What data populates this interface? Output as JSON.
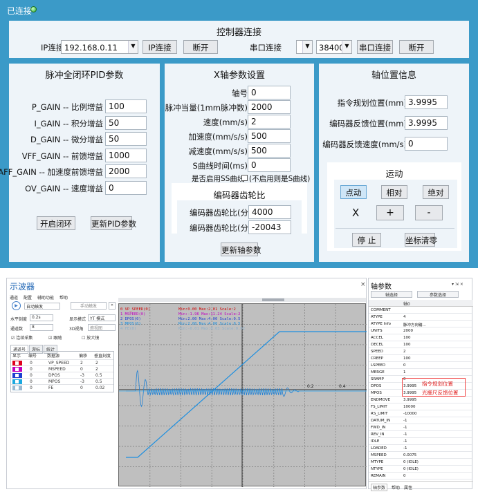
{
  "title_bar": {
    "status": "已连接"
  },
  "connect": {
    "title": "控制器连接",
    "ip_label": "IP连接",
    "ip_value": "192.168.0.11",
    "ip_button": "IP连接",
    "disconnect1": "断开",
    "serial_label": "串口连接",
    "baud_value": "38400",
    "serial_button": "串口连接",
    "disconnect2": "断开"
  },
  "pid": {
    "title": "脉冲全闭环PID参数",
    "rows": [
      {
        "label": "P_GAIN -- 比例增益",
        "value": "100"
      },
      {
        "label": "I_GAIN -- 积分增益",
        "value": "50"
      },
      {
        "label": "D_GAIN -- 微分增益",
        "value": "50"
      },
      {
        "label": "VFF_GAIN -- 前馈增益",
        "value": "1000"
      },
      {
        "label": "AFF_GAIN -- 加速度前馈增益",
        "value": "2000"
      },
      {
        "label": "OV_GAIN -- 速度增益",
        "value": "0"
      }
    ],
    "open_loop_button": "开启闭环",
    "update_button": "更新PID参数"
  },
  "xaxis": {
    "title": "X轴参数设置",
    "rows": [
      {
        "label": "轴号",
        "value": "0"
      },
      {
        "label": "脉冲当量(1mm脉冲数)",
        "value": "2000"
      },
      {
        "label": "速度(mm/s)",
        "value": "2"
      },
      {
        "label": "加速度(mm/s/s)",
        "value": "500"
      },
      {
        "label": "减速度(mm/s/s)",
        "value": "500"
      },
      {
        "label": "S曲线时间(ms)",
        "value": "0"
      }
    ],
    "s_curve_label": "是否启用SS曲线",
    "s_curve_note": "(不启用则是S曲线)",
    "gear_title": "编码器齿轮比",
    "gear_num_label": "编码器齿轮比(分子)",
    "gear_num": "4000",
    "gear_den_label": "编码器齿轮比(分母)",
    "gear_den": "-20043",
    "update_button": "更新轴参数"
  },
  "pos": {
    "title": "轴位置信息",
    "rows": [
      {
        "label": "指令规划位置(mm)",
        "value": "3.9995"
      },
      {
        "label": "编码器反馈位置(mm)",
        "value": "3.9995"
      },
      {
        "label": "编码器反馈速度(mm/s)",
        "value": "0"
      }
    ]
  },
  "motion": {
    "title": "运动",
    "jog": "点动",
    "relative": "相对",
    "absolute": "绝对",
    "axis": "X",
    "plus": "+",
    "minus": "-",
    "stop": "停 止",
    "zero": "坐标清零"
  },
  "scope": {
    "title": "示波器",
    "close": "×",
    "menu": [
      "通道",
      "配置",
      "辅助功能",
      "帮助"
    ],
    "trigger_mode": "自动触发",
    "manual_trigger": "手动触发",
    "hscale_label": "水平刻度",
    "hscale_value": "0.2s",
    "display_label": "显示模式",
    "display_value": "YT 模式",
    "vscale_label": "通道数",
    "vscale_value": "8",
    "view3d_label": "3D视角",
    "view3d_value": "俯视图",
    "cb_continuous": "连续采集",
    "cb_follow": "跟随",
    "cb_zoom": "放大镜",
    "tabs": [
      "通道号",
      "游标",
      "统计"
    ],
    "headers": [
      "显示",
      "编号",
      "数据源",
      "偏移",
      "垂直刻度"
    ],
    "channels": [
      {
        "color": "#e0001b",
        "num": "0",
        "src": "VP_SPEED",
        "offset": "2",
        "scale": "2"
      },
      {
        "color": "#c000c0",
        "num": "0",
        "src": "MSPEED",
        "offset": "0",
        "scale": "2"
      },
      {
        "color": "#1b3fd0",
        "num": "0",
        "src": "DPOS",
        "offset": "-3",
        "scale": "0.5"
      },
      {
        "color": "#1aa8e0",
        "num": "0",
        "src": "MPOS",
        "offset": "-3",
        "scale": "0.5"
      },
      {
        "color": "#9ab8d0",
        "num": "0",
        "src": "FE",
        "offset": "0",
        "scale": "0.02"
      }
    ],
    "plot_legend": [
      "0 VP_SPEED(0)",
      "1 MSPEED(0)",
      "2 DPOS(0)",
      "3 MPOS(0)",
      "4 FE(0)"
    ],
    "plot_stats": [
      "Min:0.00  Max:2.01  Scale:2",
      "Min:-1.96  Max:11.24  Scale:2",
      "Min:2.00  Max:4.00  Scale:0.5",
      "Min:2.00  Max:4.00  Scale:0.5",
      "Min:-0.01  Max:0.03  Scale:0.02"
    ],
    "tick_a": "0.2",
    "tick_b": "0.4"
  },
  "axisparams": {
    "title": "轴参数",
    "pin": "▾ ⇲ ×",
    "btn1": "轴选择",
    "btn2": "参数选择",
    "col_header": "轴0",
    "rows": [
      [
        "COMMENT",
        ""
      ],
      [
        "ATYPE",
        "4"
      ],
      [
        "ATYPE Info",
        "脉冲方向输..."
      ],
      [
        "UNITS",
        "2000"
      ],
      [
        "ACCEL",
        "100"
      ],
      [
        "DECEL",
        "100"
      ],
      [
        "SPEED",
        "2"
      ],
      [
        "CREEP",
        "100"
      ],
      [
        "LSPEED",
        "0"
      ],
      [
        "MERGE",
        "1"
      ],
      [
        "SRAMP",
        "0"
      ],
      [
        "DPOS",
        "3.9995"
      ],
      [
        "MPOS",
        "3.9995"
      ],
      [
        "ENDMOVE",
        "3.9995"
      ],
      [
        "FS_LIMIT",
        "10000"
      ],
      [
        "RS_LIMIT",
        "-10000"
      ],
      [
        "DATUM_IN",
        "-1"
      ],
      [
        "FWD_IN",
        "-1"
      ],
      [
        "REV_IN",
        "-1"
      ],
      [
        "IDLE",
        "-1"
      ],
      [
        "LOADED",
        "-1"
      ],
      [
        "MSPEED",
        "0.0075"
      ],
      [
        "MTYPE",
        "0 (IDLE)"
      ],
      [
        "NTYPE",
        "0 (IDLE)"
      ],
      [
        "REMAIN",
        "0"
      ]
    ],
    "note1": "指令规划位置",
    "note2": "光栅尺反馈位置",
    "tabs": [
      "轴参数",
      "帮助",
      "属性"
    ]
  }
}
